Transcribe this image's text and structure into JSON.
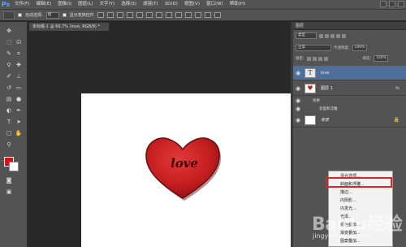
{
  "app": {
    "logo": "Ps",
    "menus": [
      "文件(F)",
      "编辑(E)",
      "图像(I)",
      "图层(L)",
      "文字(Y)",
      "选择(S)",
      "滤镜(T)",
      "3D(D)",
      "视图(V)",
      "窗口(W)",
      "帮助(H)"
    ]
  },
  "options_bar": {
    "auto_select_label": "自动选择:",
    "auto_select_value": "组",
    "show_transform_label": "显示变换控件"
  },
  "document": {
    "tab_label": "未标题-1 @ 66.7% (love, RGB/8) *",
    "heart_text": "love",
    "heart_color": "#c41e20"
  },
  "toolbox": {
    "foreground_color": "#d0161d",
    "background_color": "#ffffff"
  },
  "layers_panel": {
    "title": "图层",
    "kind_filter": "类型",
    "blend_mode": "正常",
    "opacity_label": "不透明度:",
    "opacity_value": "100%",
    "lock_label": "锁定:",
    "fill_label": "填充:",
    "fill_value": "100%",
    "layers": [
      {
        "name": "love",
        "thumb": "T",
        "selected": true
      },
      {
        "name": "图层 1",
        "thumb": "♥",
        "fx": "fx",
        "effects_label": "效果",
        "effect_item": "斜面和浮雕"
      },
      {
        "name": "背景",
        "thumb": "",
        "locked": true
      }
    ]
  },
  "context_menu": {
    "items": [
      "混合选项...",
      "斜面和浮雕...",
      "描边...",
      "内阴影...",
      "内发光...",
      "光泽...",
      "颜色叠加...",
      "渐变叠加...",
      "图案叠加..."
    ],
    "highlighted_index": 1
  },
  "watermark": {
    "brand": "Baidu经验",
    "url": "jingyan.baidu.com"
  }
}
